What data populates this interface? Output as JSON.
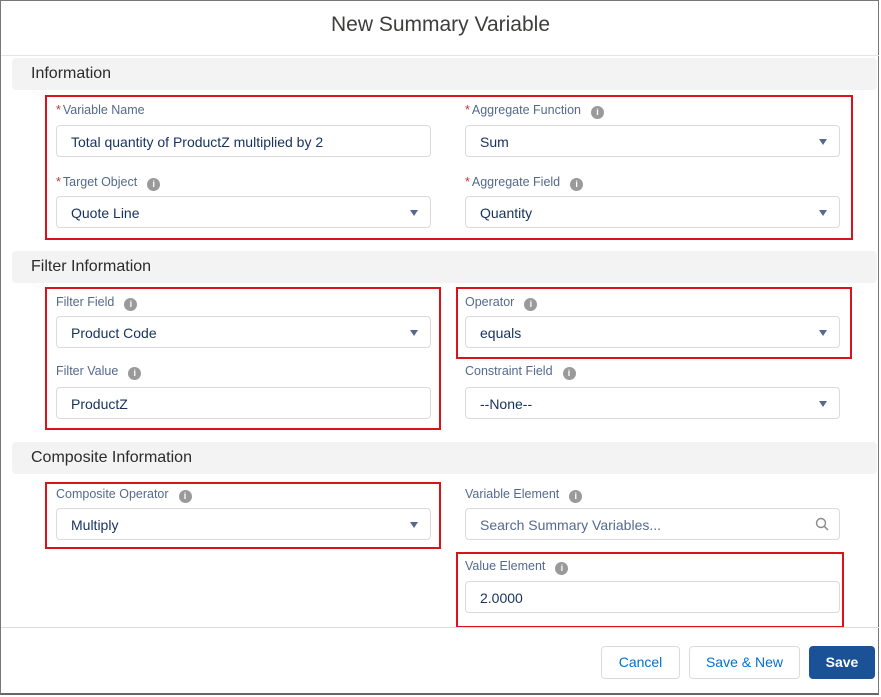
{
  "dialog": {
    "title": "New Summary Variable"
  },
  "sections": {
    "information": "Information",
    "filter": "Filter Information",
    "composite": "Composite Information"
  },
  "fields": {
    "variable_name": {
      "label": "Variable Name",
      "required": "*",
      "value": "Total quantity of ProductZ multiplied by 2"
    },
    "aggregate_function": {
      "label": "Aggregate Function",
      "required": "*",
      "value": "Sum"
    },
    "target_object": {
      "label": "Target Object",
      "required": "*",
      "value": "Quote Line"
    },
    "aggregate_field": {
      "label": "Aggregate Field",
      "required": "*",
      "value": "Quantity"
    },
    "filter_field": {
      "label": "Filter Field",
      "value": "Product Code"
    },
    "operator": {
      "label": "Operator",
      "value": "equals"
    },
    "filter_value": {
      "label": "Filter Value",
      "value": "ProductZ"
    },
    "constraint_field": {
      "label": "Constraint Field",
      "value": "--None--"
    },
    "composite_operator": {
      "label": "Composite Operator",
      "value": "Multiply"
    },
    "variable_element": {
      "label": "Variable Element",
      "placeholder": "Search Summary Variables..."
    },
    "value_element": {
      "label": "Value Element",
      "value": "2.0000"
    }
  },
  "info_glyph": "i",
  "buttons": {
    "cancel": "Cancel",
    "save_new": "Save & New",
    "save": "Save"
  },
  "colors": {
    "highlight": "#d9121c",
    "brand": "#1b5297",
    "link": "#0070d2"
  }
}
